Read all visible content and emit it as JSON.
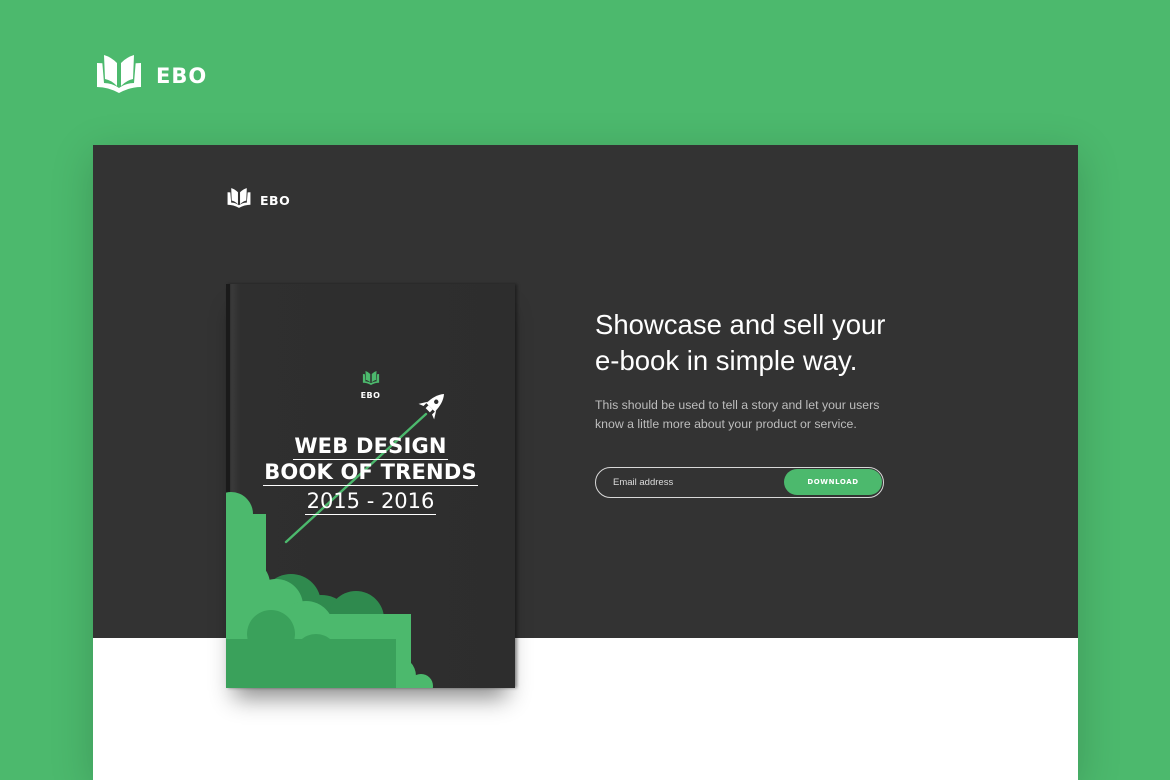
{
  "brand": {
    "name": "EBO"
  },
  "book": {
    "brand": "EBO",
    "title_line1": "WEB DESIGN",
    "title_line2": "BOOK OF TRENDS",
    "years": "2015 - 2016"
  },
  "hero": {
    "headline_line1": "Showcase and sell your",
    "headline_line2": "e-book in simple way.",
    "description_line1": "This should be used to tell a story and let your users",
    "description_line2": "know a little more about your product or service."
  },
  "form": {
    "email_placeholder": "Email address",
    "download_label": "DOWNLOAD"
  },
  "colors": {
    "accent": "#4cb96d",
    "hero_bg": "#333333",
    "page_bg": "#ffffff"
  }
}
